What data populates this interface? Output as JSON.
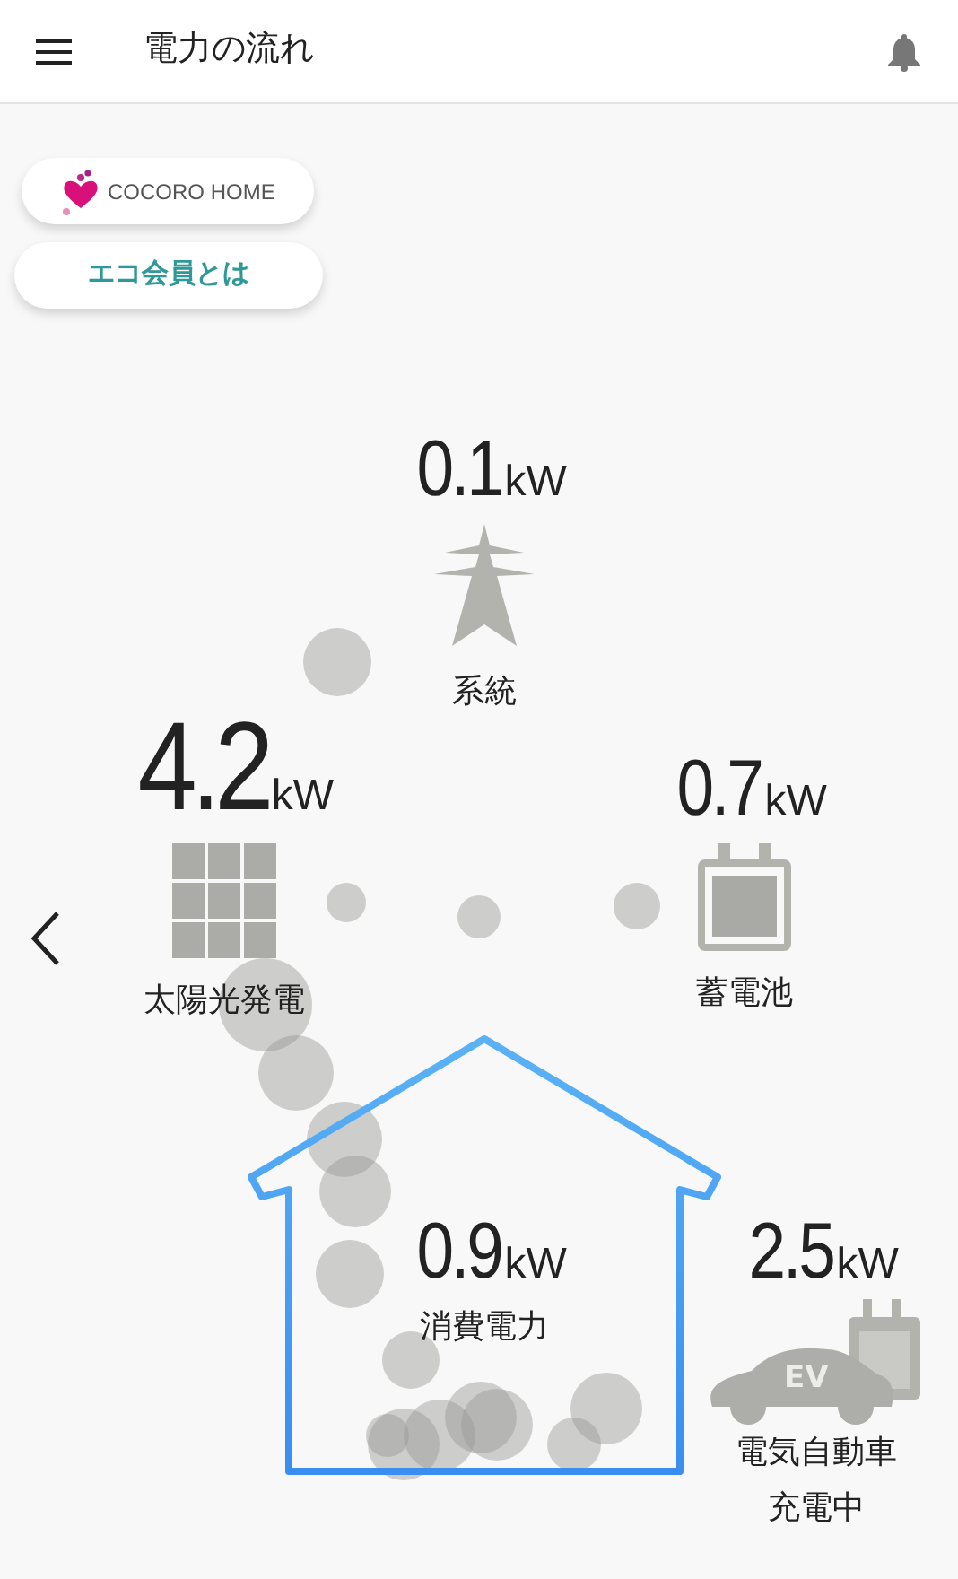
{
  "header": {
    "title": "電力の流れ"
  },
  "buttons": [
    {
      "kind": "logo",
      "label": "COCORO HOME"
    },
    {
      "kind": "text",
      "label": "エコ会員とは"
    }
  ],
  "nodes": [
    {
      "kind": "grid",
      "value": "0.1",
      "unit": "kW",
      "label": "系統"
    },
    {
      "kind": "solar",
      "value": "4.2",
      "unit": "kW",
      "label": "太陽光発電"
    },
    {
      "kind": "battery",
      "value": "0.7",
      "unit": "kW",
      "label": "蓄電池"
    },
    {
      "kind": "house",
      "value": "0.9",
      "unit": "kW",
      "label": "消費電力"
    },
    {
      "kind": "ev",
      "value": "2.5",
      "unit": "kW",
      "label": "電気自動車",
      "status": "充電中",
      "badge": "EV"
    }
  ]
}
